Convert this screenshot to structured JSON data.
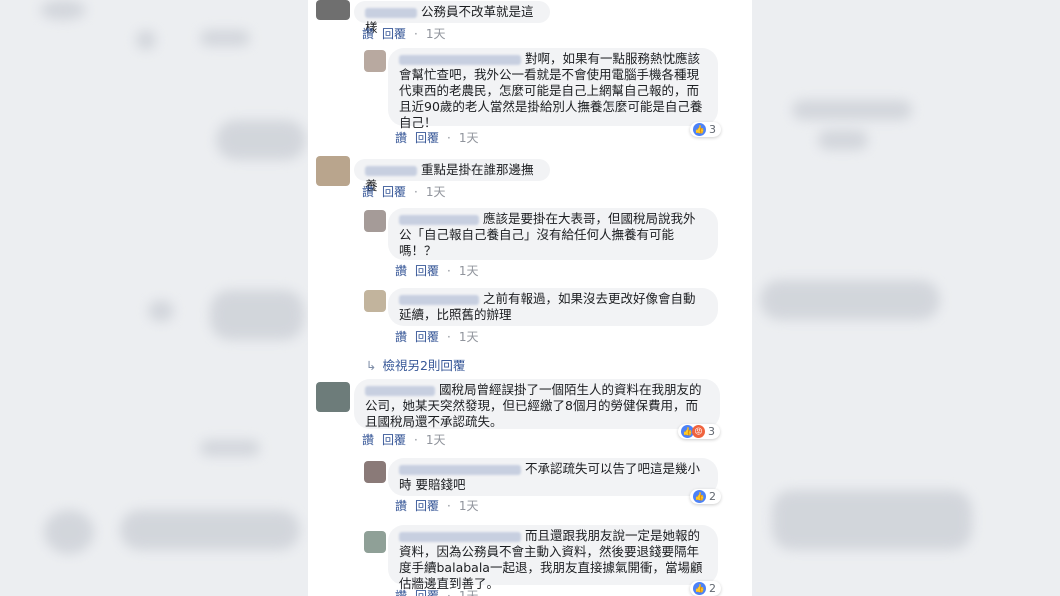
{
  "actions": {
    "say": "讚",
    "reply": "回覆",
    "dot": "·"
  },
  "comments": [
    {
      "text": "公務員不改革就是這樣",
      "time": "1天"
    },
    {
      "text": "對啊，如果有一點服務熱忱應該會幫忙查吧，我外公一看就是不會使用電腦手機各種現代東西的老農民，怎麼可能是自己上網幫自己報的，而且近90歲的老人當然是掛給別人撫養怎麼可能是自己養自己！",
      "time": "1天",
      "reactions": "3"
    },
    {
      "text": "重點是掛在誰那邊撫養",
      "time": "1天"
    },
    {
      "text": "應該是要掛在大表哥，但國稅局說我外公「自己報自己養自己」沒有給任何人撫養有可能嗎！？",
      "time": "1天"
    },
    {
      "text": "之前有報過，如果沒去更改好像會自動延續，比照舊的辦理",
      "time": "1天"
    },
    {
      "text": "國稅局曾經誤掛了一個陌生人的資料在我朋友的公司，她某天突然發現，但已經繳了8個月的勞健保費用，而且國稅局還不承認疏失。",
      "time": "1天",
      "reactions": "3"
    },
    {
      "text": "不承認疏失可以告了吧這是幾小時 要賠錢吧",
      "time": "1天",
      "reactions": "2"
    },
    {
      "text": "而且還跟我朋友說一定是她報的資料，因為公務員不會主動入資料，然後要退錢要隔年度手續balabala一起退，我朋友直接據氣開衝，當場顧估牆邊直到善了。",
      "time": "1天",
      "reactions": "2"
    }
  ],
  "more_replies": {
    "label": "檢視另2則回覆"
  }
}
